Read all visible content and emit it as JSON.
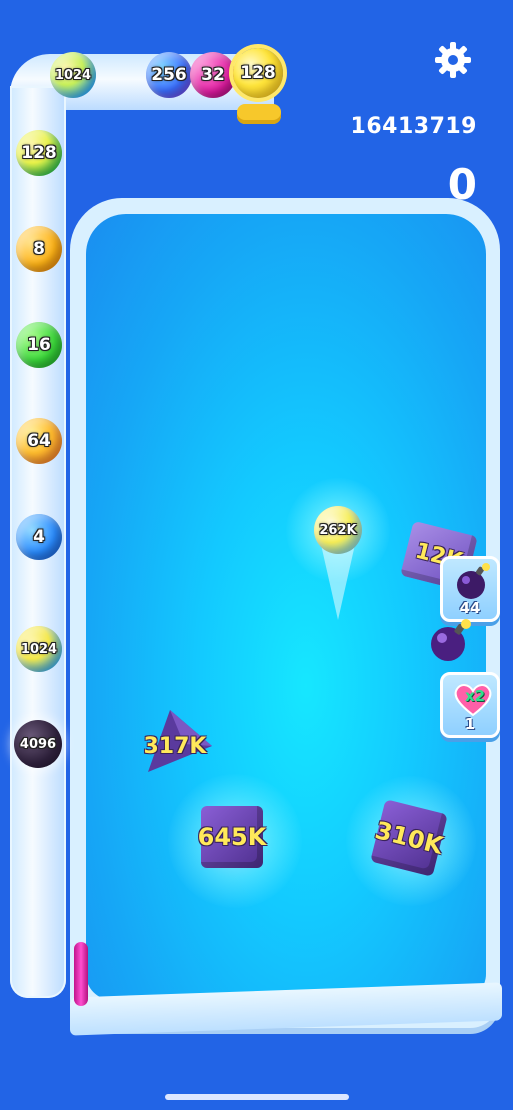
{
  "hud": {
    "score": "16413719",
    "combo": "0"
  },
  "chute": {
    "top_balls": [
      "1024",
      "256",
      "32",
      "128"
    ],
    "side_balls": [
      "128",
      "8",
      "16",
      "64",
      "4",
      "1024",
      "4096"
    ]
  },
  "field": {
    "shot_ball": "262K",
    "blocks": [
      "12K",
      "317K",
      "645K",
      "310K"
    ]
  },
  "powerups": {
    "bomb_count": "44",
    "heart_label": "x2",
    "heart_count": "1"
  },
  "colors": {
    "background": "#2264e6",
    "field": "#13c9ff",
    "block": "#5a3a9e",
    "block_text": "#ffe95a"
  },
  "icons": {
    "settings": "gear-icon",
    "bomb": "bomb-icon",
    "heart": "heart-icon"
  }
}
